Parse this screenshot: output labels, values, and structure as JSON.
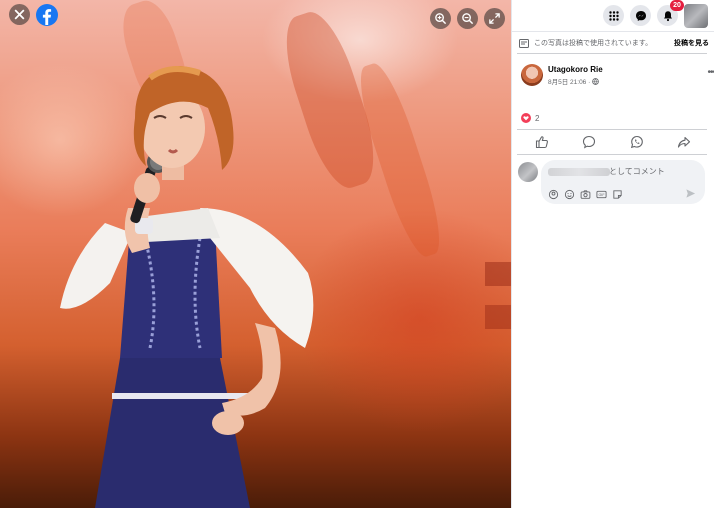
{
  "viewer": {
    "close_label": "close",
    "zoom_in": "zoom-in",
    "zoom_out": "zoom-out",
    "fullscreen": "fullscreen"
  },
  "topbar": {
    "notification_count": "20"
  },
  "notice": {
    "text": "この写真は投稿で使用されています。",
    "link": "投稿を見る"
  },
  "post": {
    "author": "Utagokoro Rie",
    "time": "8月5日 21:06 ·"
  },
  "reactions": {
    "count": "2"
  },
  "comment": {
    "placeholder_suffix": "としてコメント"
  },
  "colors": {
    "facebook_blue": "#1877f2",
    "notification_red": "#e41e3f",
    "love_red": "#f33e58"
  }
}
